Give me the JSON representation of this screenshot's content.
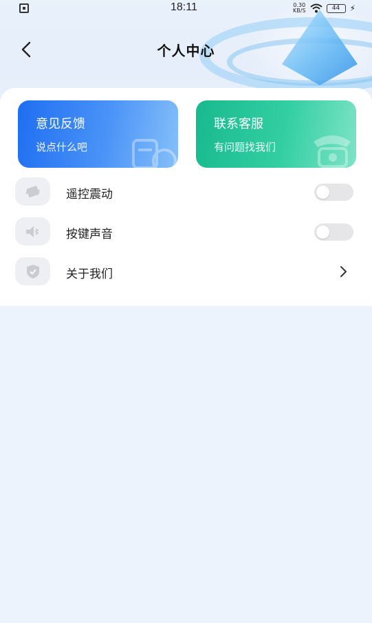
{
  "status_bar": {
    "time": "18:11",
    "net_speed_value": "0.30",
    "net_speed_unit": "KB/S",
    "battery": "44"
  },
  "header": {
    "title": "个人中心"
  },
  "cards": {
    "feedback": {
      "title": "意见反馈",
      "subtitle": "说点什么吧"
    },
    "service": {
      "title": "联系客服",
      "subtitle": "有问题找我们"
    }
  },
  "settings": {
    "vibration": {
      "label": "遥控震动",
      "enabled": false
    },
    "key_sound": {
      "label": "按键声音",
      "enabled": false
    },
    "about": {
      "label": "关于我们"
    }
  },
  "colors": {
    "feedback_card": "#1f6ef2",
    "service_card": "#18b98f",
    "page_background": "#edf3fc"
  }
}
